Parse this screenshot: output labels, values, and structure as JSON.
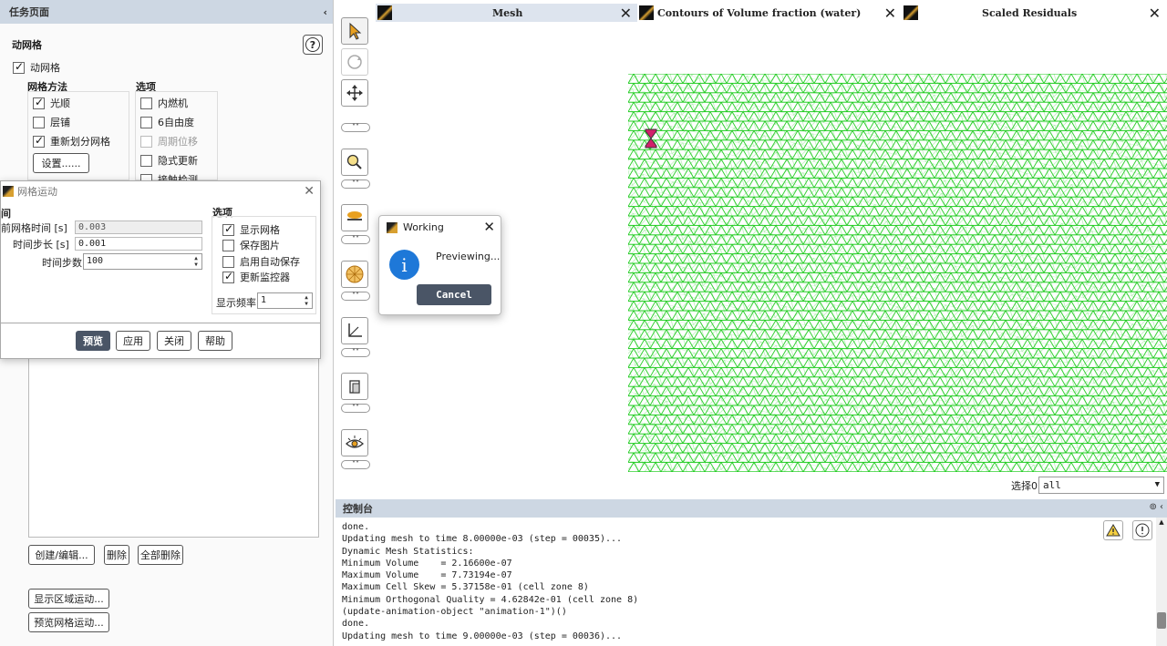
{
  "task_panel": {
    "header": "任务页面",
    "collapse_glyph": "‹",
    "section_title": "动网格",
    "help_glyph": "?",
    "dynamic_mesh_label": "动网格",
    "mesh_methods_title": "网格方法",
    "methods": [
      {
        "label": "光顺",
        "checked": true
      },
      {
        "label": "层铺",
        "checked": false
      },
      {
        "label": "重新划分网格",
        "checked": true
      }
    ],
    "settings_button": "设置......",
    "options_title": "选项",
    "options": [
      {
        "label": "内燃机",
        "checked": false,
        "disabled": false
      },
      {
        "label": "6自由度",
        "checked": false,
        "disabled": false
      },
      {
        "label": "周期位移",
        "checked": false,
        "disabled": true
      },
      {
        "label": "隐式更新",
        "checked": false,
        "disabled": false
      },
      {
        "label": "接触检测",
        "checked": false,
        "disabled": false
      }
    ],
    "create_edit_button": "创建/编辑...",
    "delete_button": "删除",
    "delete_all_button": "全部删除",
    "display_zone_motion_button": "显示区域运动...",
    "preview_mesh_motion_button": "预览网格运动..."
  },
  "mesh_motion_dialog": {
    "title": "网格运动",
    "time_group_title": "间",
    "current_time_label": "前网格时间 [s]",
    "current_time_value": "0.003",
    "time_step_label": "时间步长 [s]",
    "time_step_value": "0.001",
    "num_steps_label": "时间步数",
    "num_steps_value": "100",
    "options_title": "选项",
    "options": [
      {
        "label": "显示网格",
        "checked": true
      },
      {
        "label": "保存图片",
        "checked": false
      },
      {
        "label": "启用自动保存",
        "checked": false
      },
      {
        "label": "更新监控器",
        "checked": true
      }
    ],
    "display_freq_label": "显示频率",
    "display_freq_value": "1",
    "buttons": {
      "preview": "预览",
      "apply": "应用",
      "close": "关闭",
      "help": "帮助"
    }
  },
  "tabs": [
    {
      "label": "Mesh",
      "active": true
    },
    {
      "label": "Contours of Volume fraction (water)",
      "active": false
    },
    {
      "label": "Scaled Residuals",
      "active": false
    }
  ],
  "working_dialog": {
    "title": "Working",
    "message": "Previewing...",
    "info_glyph": "i",
    "cancel": "Cancel"
  },
  "select": {
    "label": "选择0",
    "value": "all"
  },
  "console": {
    "title": "控制台",
    "lines": [
      "done.",
      "Updating mesh to time 8.00000e-03 (step = 00035)...",
      "Dynamic Mesh Statistics:",
      "Minimum Volume    = 2.16600e-07",
      "Maximum Volume    = 7.73194e-07",
      "Maximum Cell Skew = 5.37158e-01 (cell zone 8)",
      "Minimum Orthogonal Quality = 4.62842e-01 (cell zone 8)",
      "(update-animation-object \"animation-1\")()",
      "",
      "done.",
      "Updating mesh to time 9.00000e-03 (step = 00036)..."
    ]
  },
  "colors": {
    "mesh": "#22cc22",
    "accent": "#4a5566",
    "header": "#cdd7e3"
  }
}
